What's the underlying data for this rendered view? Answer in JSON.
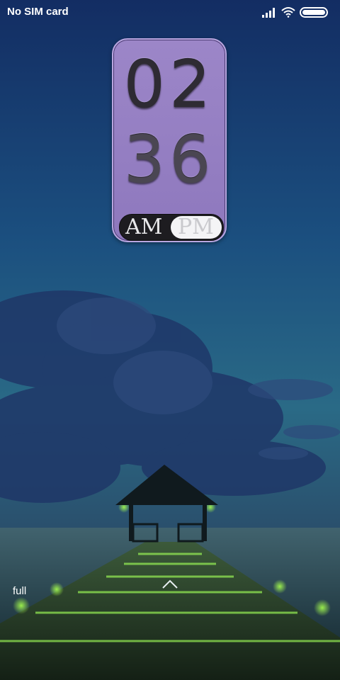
{
  "status_bar": {
    "carrier": "No SIM card",
    "icons": [
      "signal-icon",
      "wifi-icon",
      "battery-icon"
    ]
  },
  "clock": {
    "hour": "02",
    "minute": "36",
    "am_label": "AM",
    "pm_label": "PM",
    "active_period": "PM",
    "widget_color": "#9c86c8"
  },
  "lock_screen": {
    "label": "full",
    "swipe_icon": "chevron-up-icon"
  }
}
